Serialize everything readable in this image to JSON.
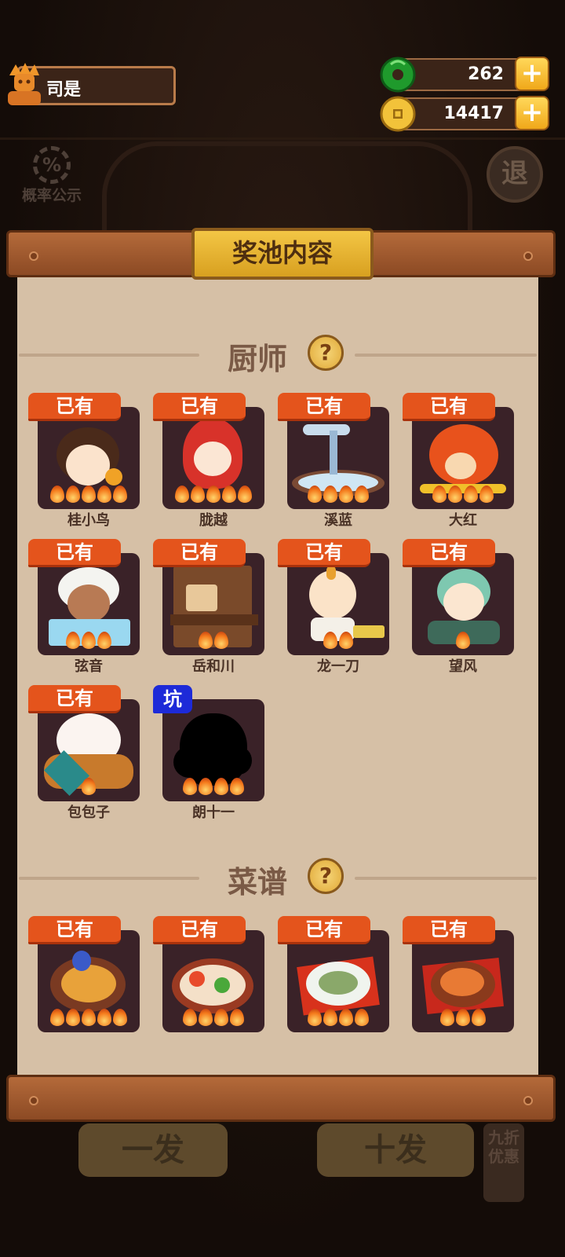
{
  "player": {
    "name": "司是"
  },
  "resources": {
    "jade": {
      "value": "262",
      "icon": "jade-coin-icon"
    },
    "coins": {
      "value": "14417",
      "icon": "gold-coin-icon"
    }
  },
  "probability": {
    "label": "概率公示",
    "icon_text": "%"
  },
  "exit": {
    "label": "退"
  },
  "background_buttons": {
    "single": "一发",
    "ten": "十发",
    "discount": "九折优惠"
  },
  "panel": {
    "title": "奖池内容",
    "sections": {
      "chefs": {
        "title": "厨师",
        "help": "?"
      },
      "recipes": {
        "title": "菜谱",
        "help": "?"
      }
    }
  },
  "chefs": [
    {
      "name": "桂小鸟",
      "badge": "已有",
      "stars": 5
    },
    {
      "name": "胧越",
      "badge": "已有",
      "stars": 5
    },
    {
      "name": "溪蓝",
      "badge": "已有",
      "stars": 4
    },
    {
      "name": "大红",
      "badge": "已有",
      "stars": 4
    },
    {
      "name": "弦音",
      "badge": "已有",
      "stars": 3
    },
    {
      "name": "岳和川",
      "badge": "已有",
      "stars": 2
    },
    {
      "name": "龙一刀",
      "badge": "已有",
      "stars": 2
    },
    {
      "name": "望风",
      "badge": "已有",
      "stars": 1
    },
    {
      "name": "包包子",
      "badge": "已有",
      "stars": 1
    },
    {
      "name": "朗十一",
      "badge": "坑",
      "stars": 4
    }
  ],
  "recipes": [
    {
      "badge": "已有",
      "stars": 5
    },
    {
      "badge": "已有",
      "stars": 4
    },
    {
      "badge": "已有",
      "stars": 4
    },
    {
      "badge": "已有",
      "stars": 3
    }
  ],
  "colors": {
    "owned_badge": "#e4541c",
    "missing_badge": "#1d2ad8",
    "panel": "#d6c0a6",
    "title_plate": "#f3c645"
  }
}
